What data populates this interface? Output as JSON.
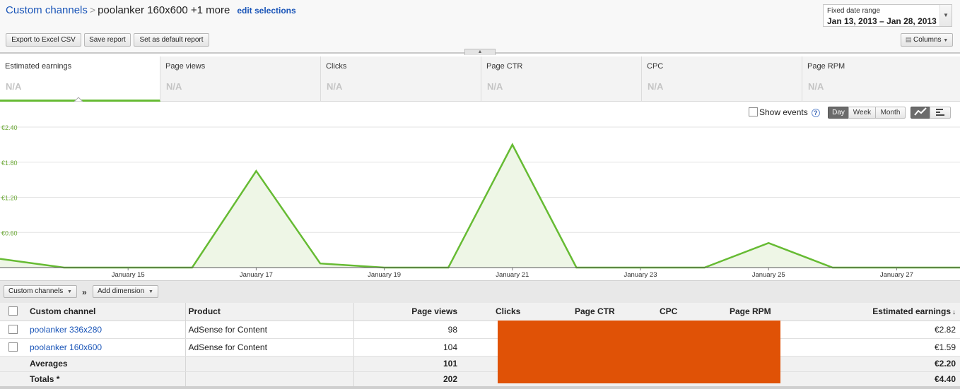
{
  "header": {
    "breadcrumb_root": "Custom channels",
    "breadcrumb_sep": ">",
    "breadcrumb_current": "poolanker 160x600 +1 more",
    "edit_selections": "edit selections"
  },
  "toolbar": {
    "export_label": "Export to Excel CSV",
    "save_label": "Save report",
    "default_label": "Set as default report",
    "columns_label": "Columns"
  },
  "date_range": {
    "label": "Fixed date range",
    "value": "Jan 13, 2013 – Jan 28, 2013"
  },
  "metrics": [
    {
      "name": "Estimated earnings",
      "value": "N/A"
    },
    {
      "name": "Page views",
      "value": "N/A"
    },
    {
      "name": "Clicks",
      "value": "N/A"
    },
    {
      "name": "Page CTR",
      "value": "N/A"
    },
    {
      "name": "CPC",
      "value": "N/A"
    },
    {
      "name": "Page RPM",
      "value": "N/A"
    }
  ],
  "chart_controls": {
    "show_events": "Show events",
    "help": "?",
    "granularity": [
      "Day",
      "Week",
      "Month"
    ],
    "active_granularity": "Day"
  },
  "colors": {
    "accent_green": "#66bb33",
    "redaction": "#e05206",
    "link_blue": "#1a55b8"
  },
  "chart_data": {
    "type": "area",
    "title": "",
    "xlabel": "",
    "ylabel": "",
    "x": [
      "Jan 13",
      "Jan 14",
      "Jan 15",
      "Jan 16",
      "Jan 17",
      "Jan 18",
      "Jan 19",
      "Jan 20",
      "Jan 21",
      "Jan 22",
      "Jan 23",
      "Jan 24",
      "Jan 25",
      "Jan 26",
      "Jan 27",
      "Jan 28"
    ],
    "values": [
      0.15,
      0.0,
      0.0,
      0.0,
      1.65,
      0.07,
      0.0,
      0.0,
      2.1,
      0.0,
      0.0,
      0.0,
      0.42,
      0.0,
      0.0,
      0.0
    ],
    "series_name": "Estimated earnings",
    "ylim": [
      0,
      2.4
    ],
    "yticks": [
      "€2.40",
      "€1.80",
      "€1.20",
      "€0.60"
    ],
    "yticks_values": [
      2.4,
      1.8,
      1.2,
      0.6
    ],
    "xticks": [
      "January 15",
      "January 17",
      "January 19",
      "January 21",
      "January 23",
      "January 25",
      "January 27"
    ],
    "grid": true,
    "legend": "none"
  },
  "dimensions": {
    "primary": "Custom channels",
    "sep": "»",
    "add": "Add dimension"
  },
  "table": {
    "headers": {
      "channel": "Custom channel",
      "product": "Product",
      "page_views": "Page views",
      "clicks": "Clicks",
      "page_ctr": "Page CTR",
      "cpc": "CPC",
      "page_rpm": "Page RPM",
      "earnings": "Estimated earnings",
      "sort_icon": "↓"
    },
    "rows": [
      {
        "channel": "poolanker 336x280",
        "product": "AdSense for Content",
        "page_views": "98",
        "earnings": "€2.82"
      },
      {
        "channel": "poolanker 160x600",
        "product": "AdSense for Content",
        "page_views": "104",
        "earnings": "€1.59"
      }
    ],
    "averages": {
      "label": "Averages",
      "page_views": "101",
      "earnings": "€2.20"
    },
    "totals": {
      "label": "Totals *",
      "page_views": "202",
      "earnings": "€4.40"
    }
  }
}
